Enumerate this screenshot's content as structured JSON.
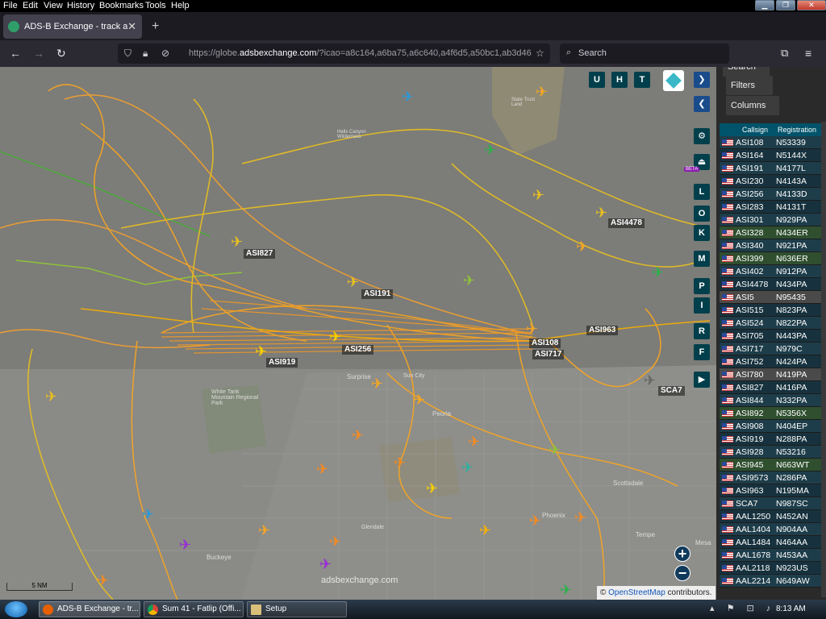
{
  "menubar": {
    "items": [
      "File",
      "Edit",
      "View",
      "History",
      "Bookmarks",
      "Tools",
      "Help"
    ]
  },
  "tab": {
    "title": "ADS-B Exchange - track aircraft"
  },
  "nav": {
    "url_prefix": "https://globe.",
    "url_domain": "adsbexchange.com",
    "url_rest": "/?icao=a8c164,a6ba75,a6c640,a4f6d5,a50bc1,ab3d46",
    "search_placeholder": "Search"
  },
  "map": {
    "top_buttons": [
      "U",
      "H",
      "T"
    ],
    "side_buttons": [
      "L",
      "O",
      "K",
      "M",
      "P",
      "I",
      "R",
      "F"
    ],
    "beta_label": "BETA",
    "aircraft_labels": [
      {
        "text": "ASI827"
      },
      {
        "text": "ASI191"
      },
      {
        "text": "ASI256"
      },
      {
        "text": "ASI919"
      },
      {
        "text": "ASI4478"
      },
      {
        "text": "ASI963"
      },
      {
        "text": "ASI108"
      },
      {
        "text": "ASI717"
      },
      {
        "text": "SCA7"
      }
    ],
    "place_labels": [
      "Surprise",
      "Sun City",
      "Peoria",
      "Scottsdale",
      "Phoenix",
      "Tempe",
      "Mesa",
      "Buckeye",
      "Glendale",
      "White Tank Mountain Regional Park",
      "Hells Canyon Wilderness",
      "State Trust Land"
    ],
    "watermark": "adsbexchange.com",
    "scale": "5 NM",
    "attribution_prefix": "©",
    "attribution_link": "OpenStreetMap",
    "attribution_suffix": "contributors."
  },
  "sidebar": {
    "buttons": [
      "Search",
      "Filters",
      "Columns"
    ],
    "columns": [
      "Callsign",
      "Registration"
    ],
    "rows": [
      {
        "callsign": "ASI108",
        "registration": "N53339"
      },
      {
        "callsign": "ASI164",
        "registration": "N5144X"
      },
      {
        "callsign": "ASI191",
        "registration": "N4177L"
      },
      {
        "callsign": "ASI230",
        "registration": "N4143A"
      },
      {
        "callsign": "ASI256",
        "registration": "N4133D"
      },
      {
        "callsign": "ASI283",
        "registration": "N4131T"
      },
      {
        "callsign": "ASI301",
        "registration": "N929PA"
      },
      {
        "callsign": "ASI328",
        "registration": "N434ER"
      },
      {
        "callsign": "ASI340",
        "registration": "N921PA"
      },
      {
        "callsign": "ASI399",
        "registration": "N636ER"
      },
      {
        "callsign": "ASI402",
        "registration": "N912PA"
      },
      {
        "callsign": "ASI4478",
        "registration": "N434PA"
      },
      {
        "callsign": "ASI5",
        "registration": "N95435"
      },
      {
        "callsign": "ASI515",
        "registration": "N823PA"
      },
      {
        "callsign": "ASI524",
        "registration": "N822PA"
      },
      {
        "callsign": "ASI705",
        "registration": "N443PA"
      },
      {
        "callsign": "ASI717",
        "registration": "N979C"
      },
      {
        "callsign": "ASI752",
        "registration": "N424PA"
      },
      {
        "callsign": "ASI780",
        "registration": "N419PA"
      },
      {
        "callsign": "ASI827",
        "registration": "N416PA"
      },
      {
        "callsign": "ASI844",
        "registration": "N332PA"
      },
      {
        "callsign": "ASI892",
        "registration": "N5356X"
      },
      {
        "callsign": "ASI908",
        "registration": "N404EP"
      },
      {
        "callsign": "ASI919",
        "registration": "N288PA"
      },
      {
        "callsign": "ASI928",
        "registration": "N53216"
      },
      {
        "callsign": "ASI945",
        "registration": "N663WT"
      },
      {
        "callsign": "ASI9573",
        "registration": "N286PA"
      },
      {
        "callsign": "ASI963",
        "registration": "N195MA"
      },
      {
        "callsign": "SCA7",
        "registration": "N987SC"
      },
      {
        "callsign": "AAL1250",
        "registration": "N452AN"
      },
      {
        "callsign": "AAL1404",
        "registration": "N904AA"
      },
      {
        "callsign": "AAL1484",
        "registration": "N464AA"
      },
      {
        "callsign": "AAL1678",
        "registration": "N453AA"
      },
      {
        "callsign": "AAL2118",
        "registration": "N923US"
      },
      {
        "callsign": "AAL2214",
        "registration": "N649AW"
      }
    ]
  },
  "taskbar": {
    "buttons": [
      "ADS-B Exchange - tr...",
      "Sum 41 - Fatlip (Offi...",
      "Setup"
    ],
    "clock": "8:13 AM"
  },
  "colors": {
    "track_orange": "#f5a623",
    "track_yellow": "#e8c020",
    "track_green": "#8fc23a",
    "map_bg": "#7c7c78",
    "table_head": "#00536a"
  }
}
